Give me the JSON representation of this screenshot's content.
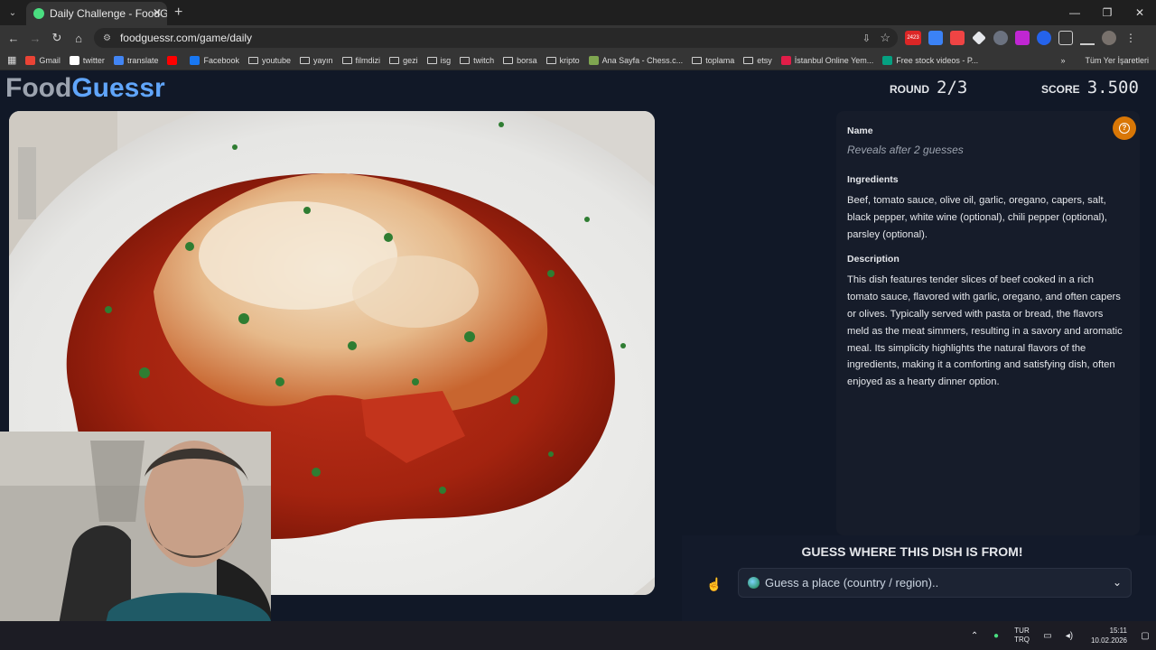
{
  "browser": {
    "tab_title": "Daily Challenge - FoodGuessr |",
    "url": "foodguessr.com/game/daily",
    "bookmarks": [
      {
        "label": "Gmail",
        "type": "site",
        "color": "#ea4335"
      },
      {
        "label": "twitter",
        "type": "site",
        "color": "#ffffff"
      },
      {
        "label": "translate",
        "type": "site",
        "color": "#4285f4"
      },
      {
        "label": "",
        "type": "site",
        "color": "#ff0000"
      },
      {
        "label": "Facebook",
        "type": "site",
        "color": "#1877f2"
      },
      {
        "label": "youtube",
        "type": "folder"
      },
      {
        "label": "yayın",
        "type": "folder"
      },
      {
        "label": "filmdizi",
        "type": "folder"
      },
      {
        "label": "gezi",
        "type": "folder"
      },
      {
        "label": "isg",
        "type": "folder"
      },
      {
        "label": "twitch",
        "type": "folder"
      },
      {
        "label": "borsa",
        "type": "folder"
      },
      {
        "label": "kripto",
        "type": "folder"
      },
      {
        "label": "Ana Sayfa - Chess.c...",
        "type": "site",
        "color": "#7fa650"
      },
      {
        "label": "toplama",
        "type": "folder"
      },
      {
        "label": "etsy",
        "type": "folder"
      },
      {
        "label": "İstanbul Online Yem...",
        "type": "site",
        "color": "#e11d48"
      },
      {
        "label": "Free stock videos - P...",
        "type": "site",
        "color": "#05a081"
      }
    ],
    "all_bookmarks_label": "Tüm Yer İşaretleri",
    "extension_badge": "2423"
  },
  "game": {
    "logo_food": "Food",
    "logo_guessr": "Guessr",
    "round_label": "ROUND",
    "round_value": "2/3",
    "score_label": "SCORE",
    "score_value": "3.500"
  },
  "info": {
    "name_title": "Name",
    "name_value": "Reveals after 2 guesses",
    "ingredients_title": "Ingredients",
    "ingredients": "Beef, tomato sauce, olive oil, garlic, oregano, capers, salt, black pepper, white wine (optional), chili pepper (optional), parsley (optional).",
    "description_title": "Description",
    "description": "This dish features tender slices of beef cooked in a rich tomato sauce, flavored with garlic, oregano, and often capers or olives. Typically served with pasta or bread, the flavors meld as the meat simmers, resulting in a savory and aromatic meal. Its simplicity highlights the natural flavors of the ingredients, making it a comforting and satisfying dish, often enjoyed as a hearty dinner option."
  },
  "guess": {
    "title": "GUESS WHERE THIS DISH IS FROM!",
    "placeholder": "Guess a place (country / region).."
  },
  "taskbar": {
    "lang_top": "TUR",
    "lang_bottom": "TRQ",
    "time": "15:11",
    "date": "10.02.2026"
  },
  "colors": {
    "page_bg": "#111827",
    "logo_food": "#9ca3af",
    "logo_guessr": "#60a5fa",
    "help_button": "#d97706"
  }
}
